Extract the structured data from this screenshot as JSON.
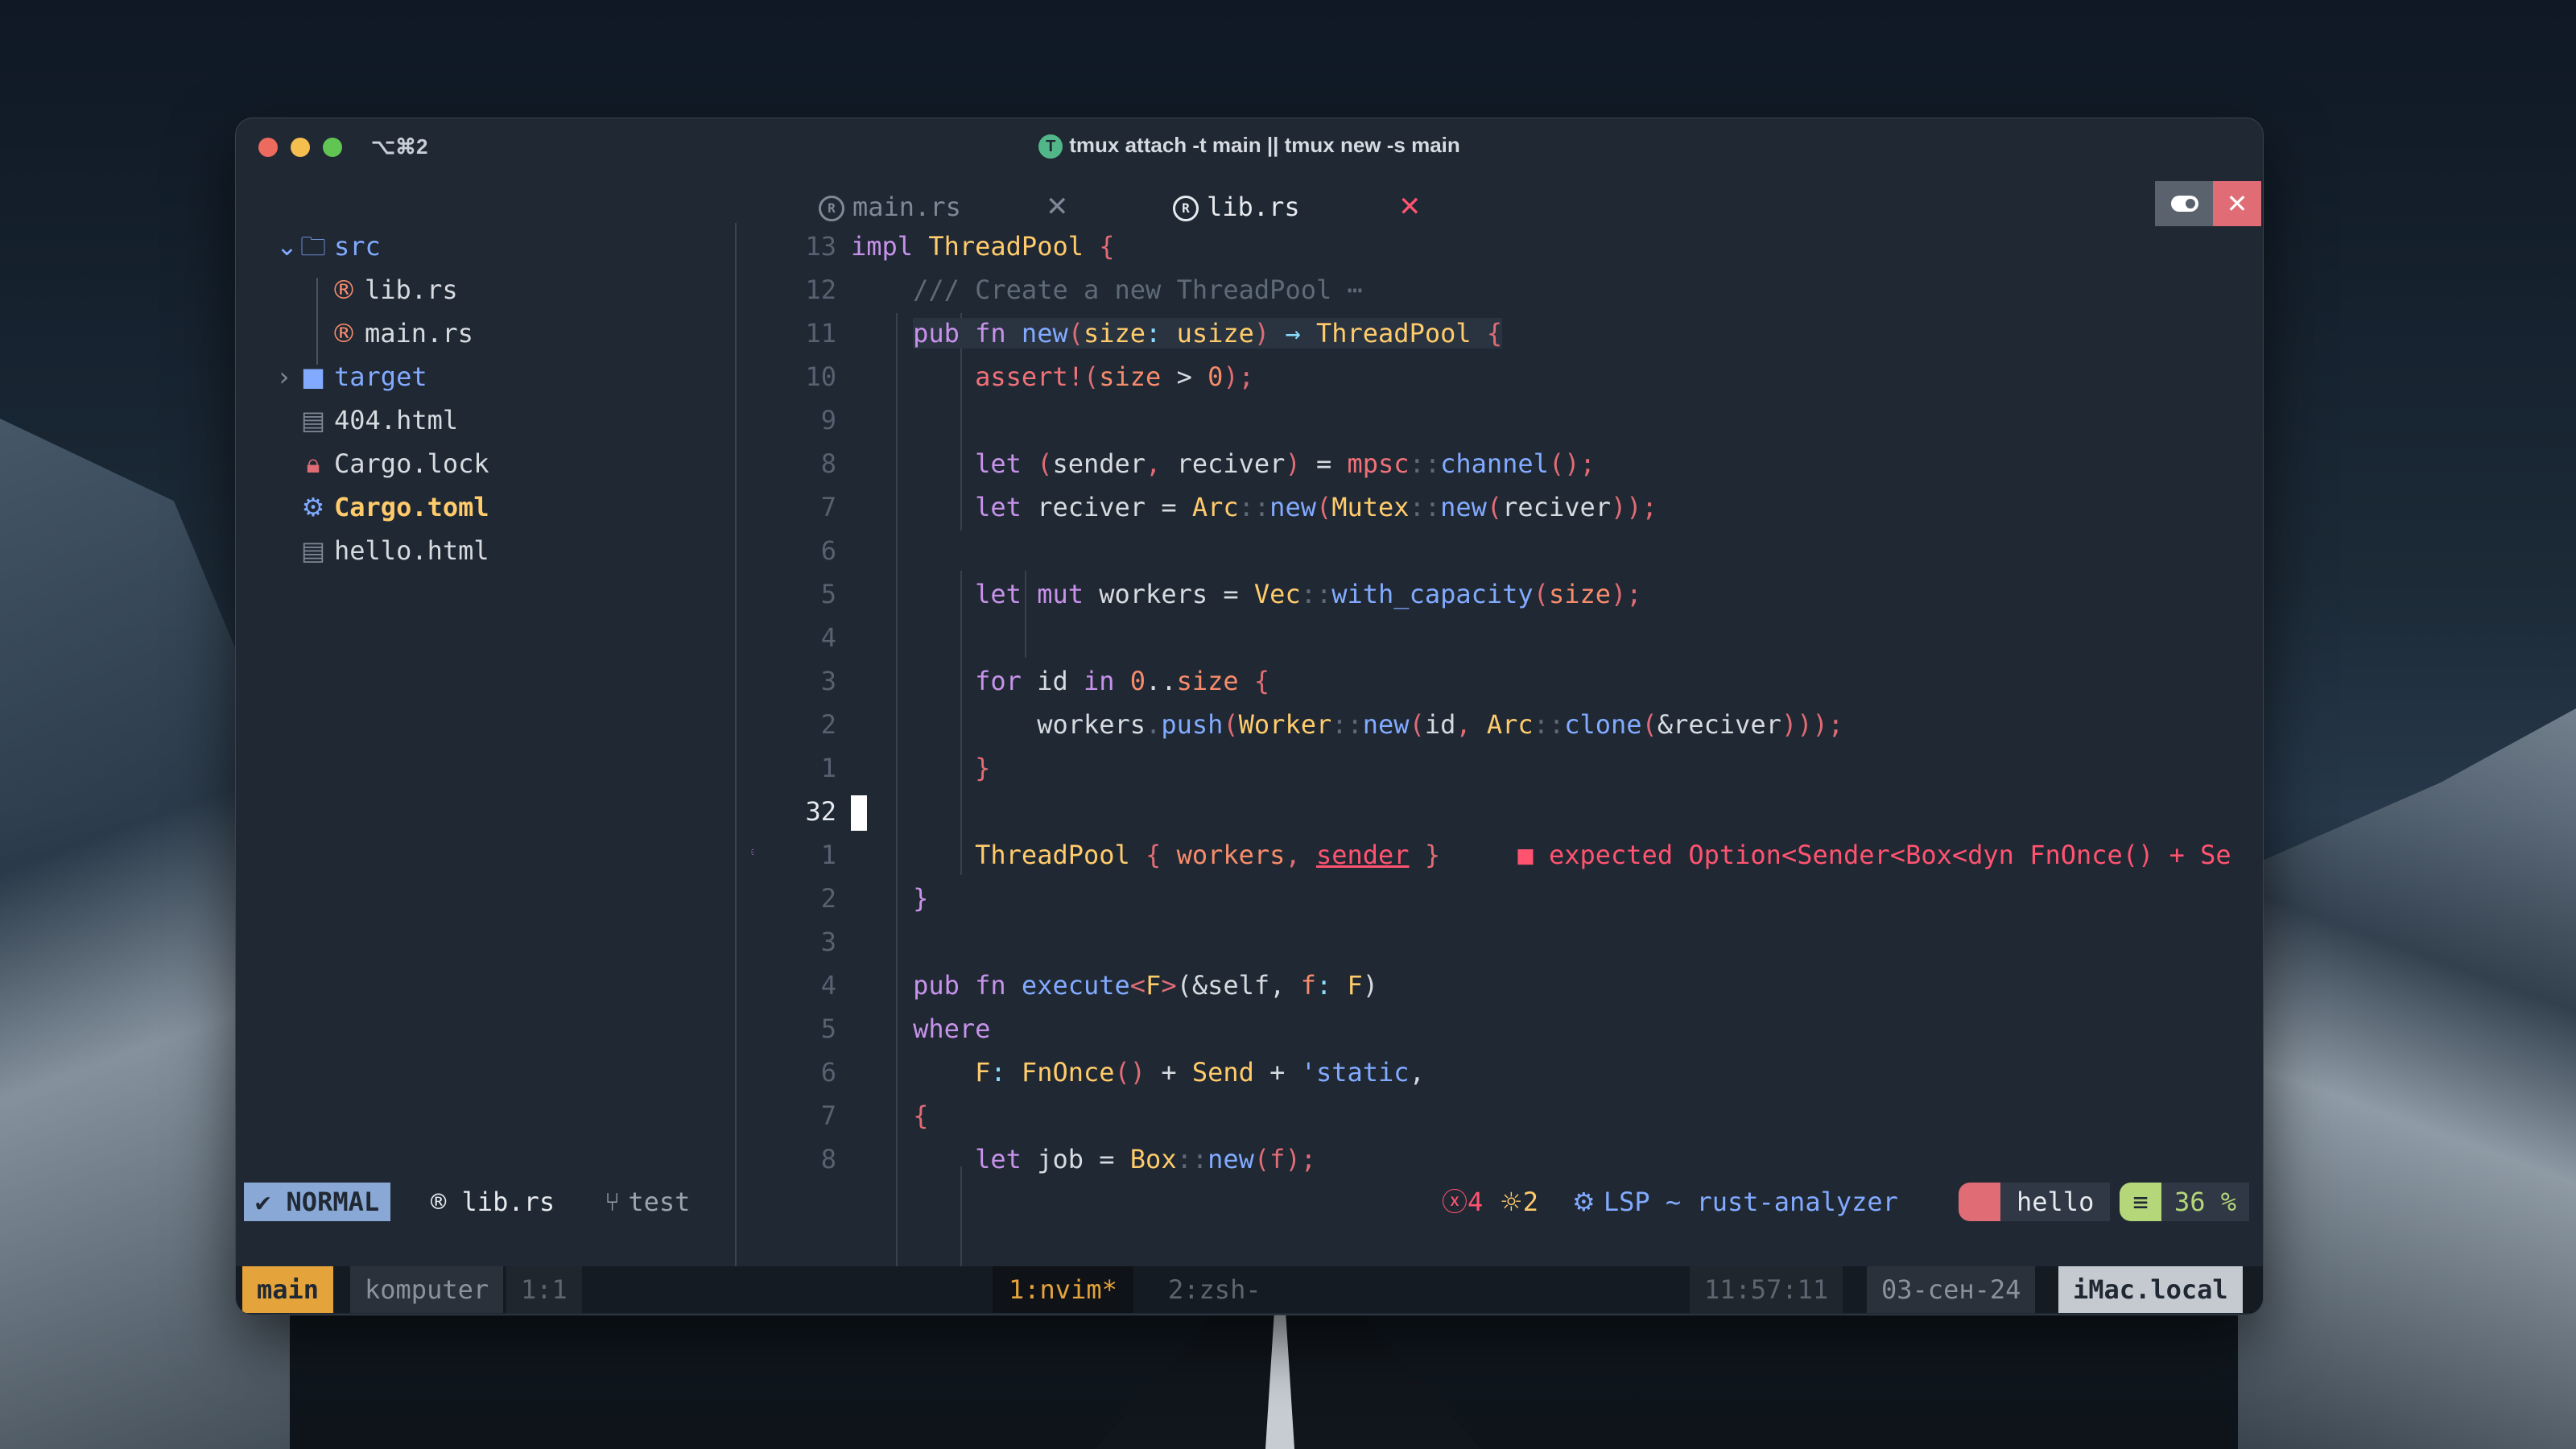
{
  "window": {
    "tab_shortcut": "⌥⌘2",
    "title_badge": "T",
    "title": "tmux attach -t main || tmux new -s main"
  },
  "tabs": [
    {
      "label": "main.rs",
      "active": false
    },
    {
      "label": "lib.rs",
      "active": true
    }
  ],
  "tree": {
    "items": [
      {
        "label": "src",
        "kind": "folder-open",
        "icon": "folder-open-icon",
        "color": "#82aaff"
      },
      {
        "label": "lib.rs",
        "kind": "file",
        "icon": "rust-icon",
        "color": "#d7dbe0"
      },
      {
        "label": "main.rs",
        "kind": "file",
        "icon": "rust-icon",
        "color": "#d7dbe0"
      },
      {
        "label": "target",
        "kind": "folder",
        "icon": "folder-icon",
        "color": "#82aaff"
      },
      {
        "label": "404.html",
        "kind": "file",
        "icon": "html-icon",
        "color": "#d7dbe0"
      },
      {
        "label": "Cargo.lock",
        "kind": "file",
        "icon": "lock-icon",
        "color": "#d7dbe0"
      },
      {
        "label": "Cargo.toml",
        "kind": "file",
        "icon": "gear-icon",
        "color": "#ffcb6b"
      },
      {
        "label": "hello.html",
        "kind": "file",
        "icon": "html-icon",
        "color": "#d7dbe0"
      }
    ]
  },
  "editor": {
    "gutter": [
      "13",
      "12",
      "11",
      "10",
      "9",
      "8",
      "7",
      "6",
      "5",
      "4",
      "3",
      "2",
      "1",
      "32",
      "1",
      "2",
      "3",
      "4",
      "5",
      "6",
      "7",
      "8"
    ],
    "lines": [
      "impl ThreadPool {",
      "    /// Create a new ThreadPool ⋯",
      "    pub fn new(size: usize) → ThreadPool {",
      "        assert!(size > 0);",
      "",
      "        let (sender, reciver) = mpsc::channel();",
      "        let reciver = Arc::new(Mutex::new(reciver));",
      "",
      "        let mut workers = Vec::with_capacity(size);",
      "",
      "        for id in 0..size {",
      "            workers.push(Worker::new(id, Arc::clone(&reciver)));",
      "        }",
      "",
      "        ThreadPool { workers, sender }",
      "    }",
      "",
      "    pub fn execute<F>(&self, f: F)",
      "    where",
      "        F: FnOnce() + Send + 'static,",
      "    {",
      "        let job = Box::new(f);"
    ],
    "diagnostic": "expected Option<Sender<Box<dyn FnOnce() + Se"
  },
  "statusline": {
    "mode": "NORMAL",
    "file": "lib.rs",
    "branch": "test",
    "errors": "4",
    "hints": "2",
    "lsp": "LSP ~ rust-analyzer",
    "folder": "hello",
    "percent": "36 %"
  },
  "tmux": {
    "session": "main",
    "user": "komputer",
    "pane": "1:1",
    "window1": "1:nvim*",
    "window2": "2:zsh-",
    "time": "11:57:11",
    "date": "03-сен-24",
    "host": "iMac.local"
  },
  "colors": {
    "keyword": "#c792ea",
    "type": "#ffcb6b",
    "function": "#82aaff",
    "error": "#ff5370",
    "mode_bg": "#89a8d6",
    "tmux_session": "#e5a33b"
  }
}
